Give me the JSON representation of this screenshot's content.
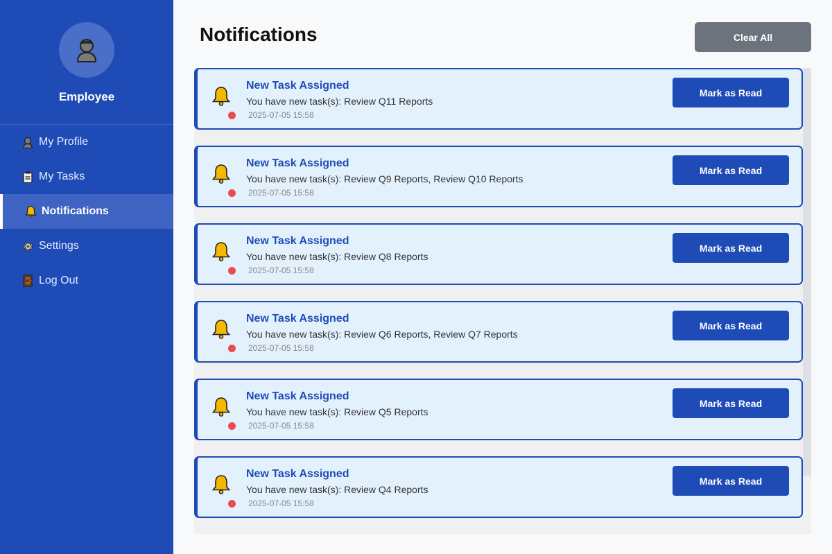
{
  "sidebar": {
    "role": "Employee",
    "nav": [
      {
        "label": "My Profile",
        "icon": "person-icon"
      },
      {
        "label": "My Tasks",
        "icon": "clipboard-icon"
      },
      {
        "label": "Notifications",
        "icon": "bell-icon",
        "active": true
      },
      {
        "label": "Settings",
        "icon": "gear-icon"
      },
      {
        "label": "Log Out",
        "icon": "door-icon"
      }
    ]
  },
  "main": {
    "title": "Notifications",
    "clear_all_label": "Clear All",
    "notifications": [
      {
        "title": "New Task Assigned",
        "message": "You have new task(s): Review Q11 Reports",
        "time": "2025-07-05 15:58",
        "action": "Mark as Read"
      },
      {
        "title": "New Task Assigned",
        "message": "You have new task(s): Review Q9 Reports, Review Q10 Reports",
        "time": "2025-07-05 15:58",
        "action": "Mark as Read"
      },
      {
        "title": "New Task Assigned",
        "message": "You have new task(s): Review Q8 Reports",
        "time": "2025-07-05 15:58",
        "action": "Mark as Read"
      },
      {
        "title": "New Task Assigned",
        "message": "You have new task(s): Review Q6 Reports, Review Q7 Reports",
        "time": "2025-07-05 15:58",
        "action": "Mark as Read"
      },
      {
        "title": "New Task Assigned",
        "message": "You have new task(s): Review Q5 Reports",
        "time": "2025-07-05 15:58",
        "action": "Mark as Read"
      },
      {
        "title": "New Task Assigned",
        "message": "You have new task(s): Review Q4 Reports",
        "time": "2025-07-05 15:58",
        "action": "Mark as Read"
      }
    ]
  },
  "colors": {
    "sidebar_bg": "#1e4bb5",
    "card_bg": "#e3f1fc",
    "unread_dot": "#e84c4f",
    "bell": "#f5b800",
    "clear_button": "#6c737d"
  }
}
